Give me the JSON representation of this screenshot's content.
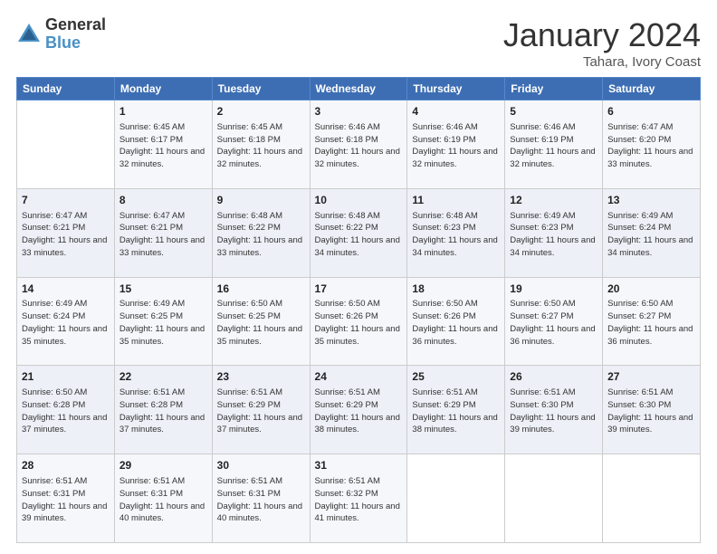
{
  "logo": {
    "general": "General",
    "blue": "Blue"
  },
  "header": {
    "month": "January 2024",
    "location": "Tahara, Ivory Coast"
  },
  "weekdays": [
    "Sunday",
    "Monday",
    "Tuesday",
    "Wednesday",
    "Thursday",
    "Friday",
    "Saturday"
  ],
  "weeks": [
    [
      {
        "day": "",
        "sunrise": "",
        "sunset": "",
        "daylight": ""
      },
      {
        "day": "1",
        "sunrise": "Sunrise: 6:45 AM",
        "sunset": "Sunset: 6:17 PM",
        "daylight": "Daylight: 11 hours and 32 minutes."
      },
      {
        "day": "2",
        "sunrise": "Sunrise: 6:45 AM",
        "sunset": "Sunset: 6:18 PM",
        "daylight": "Daylight: 11 hours and 32 minutes."
      },
      {
        "day": "3",
        "sunrise": "Sunrise: 6:46 AM",
        "sunset": "Sunset: 6:18 PM",
        "daylight": "Daylight: 11 hours and 32 minutes."
      },
      {
        "day": "4",
        "sunrise": "Sunrise: 6:46 AM",
        "sunset": "Sunset: 6:19 PM",
        "daylight": "Daylight: 11 hours and 32 minutes."
      },
      {
        "day": "5",
        "sunrise": "Sunrise: 6:46 AM",
        "sunset": "Sunset: 6:19 PM",
        "daylight": "Daylight: 11 hours and 32 minutes."
      },
      {
        "day": "6",
        "sunrise": "Sunrise: 6:47 AM",
        "sunset": "Sunset: 6:20 PM",
        "daylight": "Daylight: 11 hours and 33 minutes."
      }
    ],
    [
      {
        "day": "7",
        "sunrise": "Sunrise: 6:47 AM",
        "sunset": "Sunset: 6:21 PM",
        "daylight": "Daylight: 11 hours and 33 minutes."
      },
      {
        "day": "8",
        "sunrise": "Sunrise: 6:47 AM",
        "sunset": "Sunset: 6:21 PM",
        "daylight": "Daylight: 11 hours and 33 minutes."
      },
      {
        "day": "9",
        "sunrise": "Sunrise: 6:48 AM",
        "sunset": "Sunset: 6:22 PM",
        "daylight": "Daylight: 11 hours and 33 minutes."
      },
      {
        "day": "10",
        "sunrise": "Sunrise: 6:48 AM",
        "sunset": "Sunset: 6:22 PM",
        "daylight": "Daylight: 11 hours and 34 minutes."
      },
      {
        "day": "11",
        "sunrise": "Sunrise: 6:48 AM",
        "sunset": "Sunset: 6:23 PM",
        "daylight": "Daylight: 11 hours and 34 minutes."
      },
      {
        "day": "12",
        "sunrise": "Sunrise: 6:49 AM",
        "sunset": "Sunset: 6:23 PM",
        "daylight": "Daylight: 11 hours and 34 minutes."
      },
      {
        "day": "13",
        "sunrise": "Sunrise: 6:49 AM",
        "sunset": "Sunset: 6:24 PM",
        "daylight": "Daylight: 11 hours and 34 minutes."
      }
    ],
    [
      {
        "day": "14",
        "sunrise": "Sunrise: 6:49 AM",
        "sunset": "Sunset: 6:24 PM",
        "daylight": "Daylight: 11 hours and 35 minutes."
      },
      {
        "day": "15",
        "sunrise": "Sunrise: 6:49 AM",
        "sunset": "Sunset: 6:25 PM",
        "daylight": "Daylight: 11 hours and 35 minutes."
      },
      {
        "day": "16",
        "sunrise": "Sunrise: 6:50 AM",
        "sunset": "Sunset: 6:25 PM",
        "daylight": "Daylight: 11 hours and 35 minutes."
      },
      {
        "day": "17",
        "sunrise": "Sunrise: 6:50 AM",
        "sunset": "Sunset: 6:26 PM",
        "daylight": "Daylight: 11 hours and 35 minutes."
      },
      {
        "day": "18",
        "sunrise": "Sunrise: 6:50 AM",
        "sunset": "Sunset: 6:26 PM",
        "daylight": "Daylight: 11 hours and 36 minutes."
      },
      {
        "day": "19",
        "sunrise": "Sunrise: 6:50 AM",
        "sunset": "Sunset: 6:27 PM",
        "daylight": "Daylight: 11 hours and 36 minutes."
      },
      {
        "day": "20",
        "sunrise": "Sunrise: 6:50 AM",
        "sunset": "Sunset: 6:27 PM",
        "daylight": "Daylight: 11 hours and 36 minutes."
      }
    ],
    [
      {
        "day": "21",
        "sunrise": "Sunrise: 6:50 AM",
        "sunset": "Sunset: 6:28 PM",
        "daylight": "Daylight: 11 hours and 37 minutes."
      },
      {
        "day": "22",
        "sunrise": "Sunrise: 6:51 AM",
        "sunset": "Sunset: 6:28 PM",
        "daylight": "Daylight: 11 hours and 37 minutes."
      },
      {
        "day": "23",
        "sunrise": "Sunrise: 6:51 AM",
        "sunset": "Sunset: 6:29 PM",
        "daylight": "Daylight: 11 hours and 37 minutes."
      },
      {
        "day": "24",
        "sunrise": "Sunrise: 6:51 AM",
        "sunset": "Sunset: 6:29 PM",
        "daylight": "Daylight: 11 hours and 38 minutes."
      },
      {
        "day": "25",
        "sunrise": "Sunrise: 6:51 AM",
        "sunset": "Sunset: 6:29 PM",
        "daylight": "Daylight: 11 hours and 38 minutes."
      },
      {
        "day": "26",
        "sunrise": "Sunrise: 6:51 AM",
        "sunset": "Sunset: 6:30 PM",
        "daylight": "Daylight: 11 hours and 39 minutes."
      },
      {
        "day": "27",
        "sunrise": "Sunrise: 6:51 AM",
        "sunset": "Sunset: 6:30 PM",
        "daylight": "Daylight: 11 hours and 39 minutes."
      }
    ],
    [
      {
        "day": "28",
        "sunrise": "Sunrise: 6:51 AM",
        "sunset": "Sunset: 6:31 PM",
        "daylight": "Daylight: 11 hours and 39 minutes."
      },
      {
        "day": "29",
        "sunrise": "Sunrise: 6:51 AM",
        "sunset": "Sunset: 6:31 PM",
        "daylight": "Daylight: 11 hours and 40 minutes."
      },
      {
        "day": "30",
        "sunrise": "Sunrise: 6:51 AM",
        "sunset": "Sunset: 6:31 PM",
        "daylight": "Daylight: 11 hours and 40 minutes."
      },
      {
        "day": "31",
        "sunrise": "Sunrise: 6:51 AM",
        "sunset": "Sunset: 6:32 PM",
        "daylight": "Daylight: 11 hours and 41 minutes."
      },
      {
        "day": "",
        "sunrise": "",
        "sunset": "",
        "daylight": ""
      },
      {
        "day": "",
        "sunrise": "",
        "sunset": "",
        "daylight": ""
      },
      {
        "day": "",
        "sunrise": "",
        "sunset": "",
        "daylight": ""
      }
    ]
  ]
}
